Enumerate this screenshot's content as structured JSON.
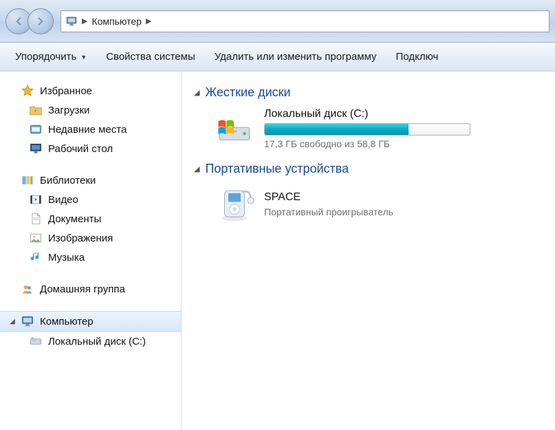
{
  "colors": {
    "section_heading": "#174a8c",
    "disk_fill": "#0aa8c4",
    "arrow": "#ff1a1a"
  },
  "breadcrumb": {
    "location": "Компьютер"
  },
  "toolbar": {
    "organize": "Упорядочить",
    "system_properties": "Свойства системы",
    "uninstall": "Удалить или изменить программу",
    "connect": "Подключ"
  },
  "sidebar": {
    "favorites": {
      "label": "Избранное",
      "items": [
        {
          "label": "Загрузки"
        },
        {
          "label": "Недавние места"
        },
        {
          "label": "Рабочий стол"
        }
      ]
    },
    "libraries": {
      "label": "Библиотеки",
      "items": [
        {
          "label": "Видео"
        },
        {
          "label": "Документы"
        },
        {
          "label": "Изображения"
        },
        {
          "label": "Музыка"
        }
      ]
    },
    "homegroup": {
      "label": "Домашняя группа"
    },
    "computer": {
      "label": "Компьютер",
      "items": [
        {
          "label": "Локальный диск (C:)"
        }
      ]
    }
  },
  "content": {
    "sections": {
      "hdd": {
        "heading": "Жесткие диски",
        "items": [
          {
            "title": "Локальный диск (C:)",
            "usage_text": "17,3 ГБ свободно из 58,8 ГБ",
            "used_percent": 70
          }
        ]
      },
      "portable": {
        "heading": "Портативные устройства",
        "items": [
          {
            "title": "SPACE",
            "subtitle": "Портативный проигрыватель"
          }
        ]
      }
    }
  }
}
